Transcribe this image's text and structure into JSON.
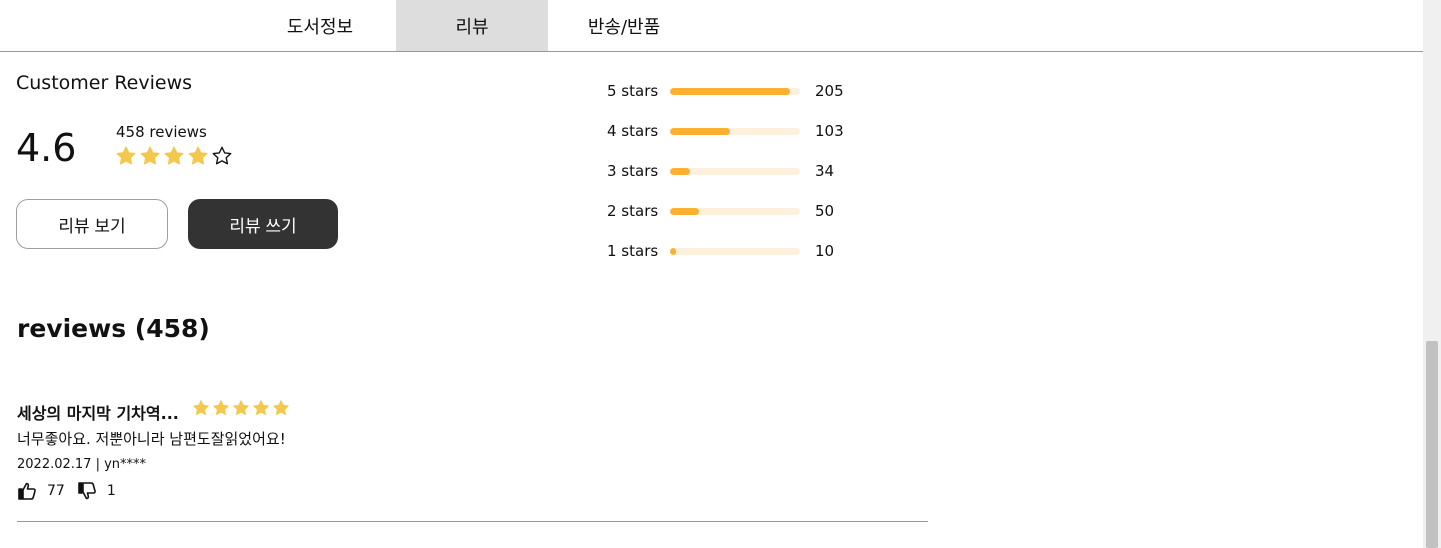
{
  "tabs": [
    {
      "label": "도서정보",
      "active": false
    },
    {
      "label": "리뷰",
      "active": true
    },
    {
      "label": "반송/반품",
      "active": false
    }
  ],
  "summary": {
    "title": "Customer Reviews",
    "average": "4.6",
    "review_count": "458 reviews",
    "rating_stars": 4,
    "max_stars": 5,
    "star_color": "#f2c94c"
  },
  "buttons": {
    "view": "리뷰 보기",
    "write": "리뷰 쓰기"
  },
  "distribution": {
    "bar_color": "#fbb030",
    "track_color": "#fdf1dd",
    "max": 205,
    "rows": [
      {
        "label": "5 stars",
        "count": "205",
        "value": 205
      },
      {
        "label": "4 stars",
        "count": "103",
        "value": 103
      },
      {
        "label": "3 stars",
        "count": "34",
        "value": 34
      },
      {
        "label": "2 stars",
        "count": "50",
        "value": 50
      },
      {
        "label": "1 stars",
        "count": "10",
        "value": 10
      }
    ]
  },
  "reviews_heading": "reviews (458)",
  "reviews": [
    {
      "title": "세상의 마지막 기차역...",
      "stars": 5,
      "body": "너무좋아요. 저뿐아니라 남편도잘읽었어요!",
      "meta": "2022.02.17 | yn****",
      "likes": "77",
      "dislikes": "1"
    }
  ]
}
